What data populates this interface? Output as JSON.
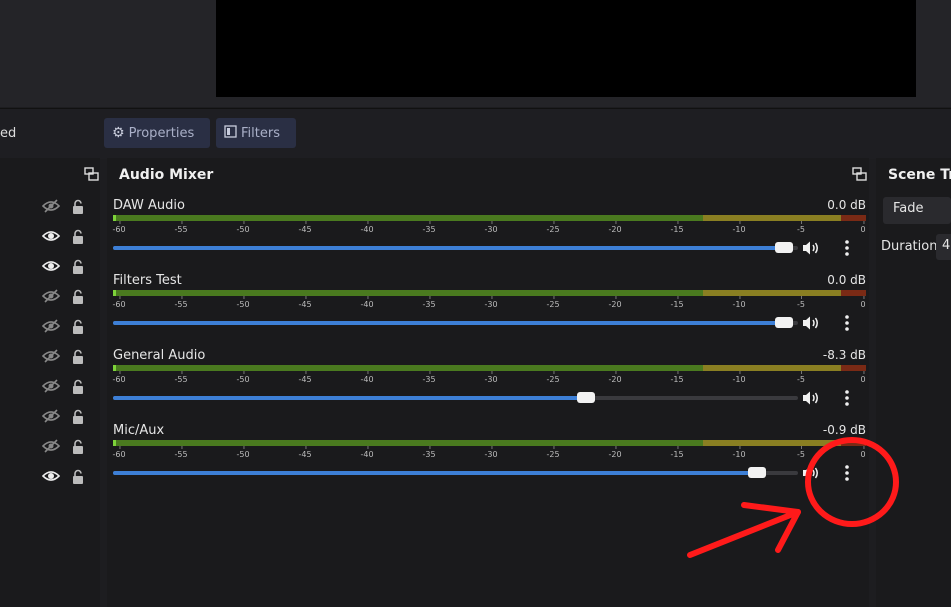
{
  "toolbar": {
    "left_text": "ed",
    "properties_label": "Properties",
    "filters_label": "Filters"
  },
  "sources_panel": {
    "rows": [
      {
        "visible": false
      },
      {
        "visible": true
      },
      {
        "visible": true
      },
      {
        "visible": false
      },
      {
        "visible": false
      },
      {
        "visible": false
      },
      {
        "visible": false
      },
      {
        "visible": false
      },
      {
        "visible": false
      },
      {
        "visible": true
      }
    ]
  },
  "mixer": {
    "title": "Audio Mixer",
    "tick_labels": [
      "-60",
      "-55",
      "-50",
      "-45",
      "-40",
      "-35",
      "-30",
      "-25",
      "-20",
      "-15",
      "-10",
      "-5",
      "0"
    ],
    "channels": [
      {
        "name": "DAW Audio",
        "db": "0.0 dB",
        "volume": 0.98
      },
      {
        "name": "Filters Test",
        "db": "0.0 dB",
        "volume": 0.98
      },
      {
        "name": "General Audio",
        "db": "-8.3 dB",
        "volume": 0.69
      },
      {
        "name": "Mic/Aux",
        "db": "-0.9 dB",
        "volume": 0.94
      }
    ]
  },
  "scene_transitions": {
    "title": "Scene Tra",
    "transition_value": "Fade",
    "duration_label": "Duration",
    "duration_value": "4"
  },
  "colors": {
    "slider_fill": "#3d7fd6",
    "meter_green": "#4a7a1f",
    "meter_yellow": "#8a7f22",
    "meter_red": "#7a2a15",
    "annotation_red": "#ff1a1a"
  },
  "icons": {
    "visible": "eye-icon",
    "hidden": "eye-slash-icon",
    "lock": "lock-icon",
    "volume": "speaker-icon",
    "menu": "kebab-menu-icon",
    "undock": "undock-icon",
    "properties": "gear-icon",
    "filters": "filter-icon"
  }
}
